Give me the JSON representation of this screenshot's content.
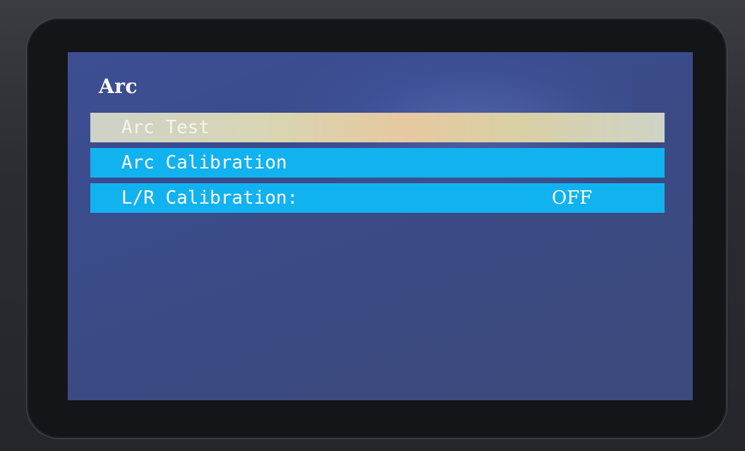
{
  "screen": {
    "title": "Arc"
  },
  "menu": {
    "items": [
      {
        "label": "Arc Test",
        "value": ""
      },
      {
        "label": "Arc Calibration",
        "value": ""
      },
      {
        "label": "L/R Calibration:",
        "value": "OFF"
      }
    ],
    "selected_index": 0
  },
  "colors": {
    "screen_background": "#3b4a8a",
    "item_highlight": "#11b2f0",
    "selected_item": "#d8d6b4",
    "text": "#ffffff"
  }
}
